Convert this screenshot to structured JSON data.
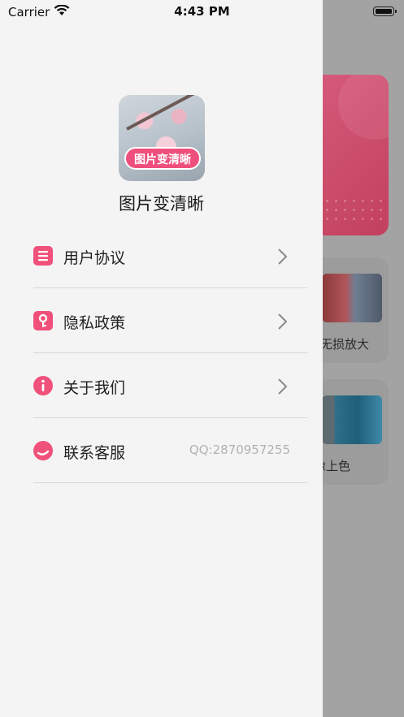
{
  "status_bar": {
    "carrier": "Carrier",
    "time": "4:43 PM"
  },
  "drawer": {
    "logo_badge": "图片变清晰",
    "app_name": "图片变清晰",
    "menu": [
      {
        "label": "用户协议",
        "icon": "document-icon"
      },
      {
        "label": "隐私政策",
        "icon": "key-icon"
      },
      {
        "label": "关于我们",
        "icon": "info-icon"
      },
      {
        "label": "联系客服",
        "icon": "chat-icon",
        "value": "QQ:2870957255"
      }
    ]
  },
  "background": {
    "card1_label": "无损放大",
    "card2_label": "像上色"
  },
  "colors": {
    "accent": "#f0517b",
    "drawer_bg": "#f4f4f4",
    "divider": "#d7d7d7",
    "overlay": "#a3a3a3"
  }
}
